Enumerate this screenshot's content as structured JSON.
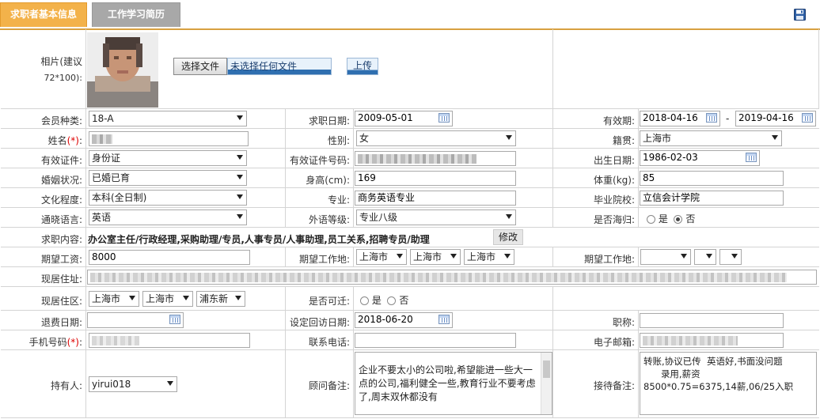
{
  "tabs": {
    "basic": "求职者基本信息",
    "history": "工作学习简历"
  },
  "photo": {
    "label": "相片(建议",
    "label2": "72*100):",
    "choose_button": "选择文件",
    "file_status": "未选择任何文件",
    "upload_button": "上传"
  },
  "row1": {
    "member_type_label": "会员种类:",
    "member_type_value": "18-A",
    "job_date_label": "求职日期:",
    "job_date_value": "2009-05-01",
    "valid_label": "有效期:",
    "valid_from": "2018-04-16",
    "valid_sep": "-",
    "valid_to": "2019-04-16"
  },
  "row2": {
    "name_label": "姓名",
    "name_req": "(*)",
    "name_colon": ":",
    "gender_label": "性别:",
    "gender_value": "女",
    "origin_label": "籍贯:",
    "origin_value": "上海市"
  },
  "row3": {
    "id_type_label": "有效证件:",
    "id_type_value": "身份证",
    "id_no_label": "有效证件号码:",
    "birth_label": "出生日期:",
    "birth_value": "1986-02-03"
  },
  "row4": {
    "marital_label": "婚姻状况:",
    "marital_value": "已婚已育",
    "height_label": "身高(cm):",
    "height_value": "169",
    "weight_label": "体重(kg):",
    "weight_value": "85"
  },
  "row5": {
    "edu_label": "文化程度:",
    "edu_value": "本科(全日制)",
    "major_label": "专业:",
    "major_value": "商务英语专业",
    "school_label": "毕业院校:",
    "school_value": "立信会计学院"
  },
  "row6": {
    "lang_label": "通晓语言:",
    "lang_value": "英语",
    "level_label": "外语等级:",
    "level_value": "专业八级",
    "overseas_label": "是否海归:",
    "yes": "是",
    "no": "否"
  },
  "row7": {
    "intent_label": "求职内容:",
    "intent_value": "办公室主任/行政经理,采购助理/专员,人事专员/人事助理,员工关系,招聘专员/助理",
    "edit_button": "修改"
  },
  "row8": {
    "salary_label": "期望工资:",
    "salary_value": "8000",
    "loc_label": "期望工作地:",
    "loc1": "上海市",
    "loc2": "上海市",
    "loc3": "上海市",
    "loc_label2": "期望工作地:"
  },
  "row9": {
    "addr_label": "现居住址:"
  },
  "row10": {
    "area_label": "现居住区:",
    "area1": "上海市",
    "area2": "上海市",
    "area3": "浦东新",
    "relocate_label": "是否可迁:",
    "yes": "是",
    "no": "否"
  },
  "row11": {
    "refund_label": "退费日期:",
    "visit_label": "设定回访日期:",
    "visit_value": "2018-06-20",
    "title_label": "职称:"
  },
  "row12": {
    "mobile_label": "手机号码",
    "mobile_req": "(*)",
    "mobile_colon": ":",
    "phone_label": "联系电话:",
    "email_label": "电子邮箱:"
  },
  "row13": {
    "holder_label": "持有人:",
    "holder_value": "yirui018",
    "consultant_label": "顾问备注:",
    "consultant_note": "企业不要太小的公司啦,希望能进一些大一点的公司,福利健全一些,教育行业不要考虑了,周末双休都没有",
    "reception_label": "接待备注:",
    "reception_note": "转账,协议已传  英语好,书面没问题\n      录用,薪资\n8500*0.75=6375,14薪,06/25入职"
  },
  "colors": {
    "tab_active": "#f3b24a",
    "tab_inactive": "#a8a8a8",
    "border": "#d4d4d4"
  }
}
